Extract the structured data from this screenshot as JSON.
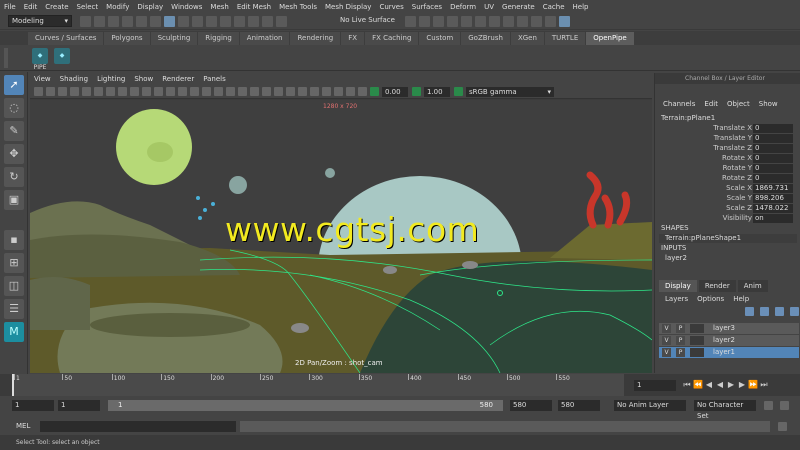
{
  "menubar": [
    "File",
    "Edit",
    "Create",
    "Select",
    "Modify",
    "Display",
    "Windows",
    "Mesh",
    "Edit Mesh",
    "Mesh Tools",
    "Mesh Display",
    "Curves",
    "Surfaces",
    "Deform",
    "UV",
    "Generate",
    "Cache",
    "Help"
  ],
  "statusline": {
    "mode": "Modeling",
    "live_surface": "No Live Surface"
  },
  "shelf": {
    "tabs": [
      "Curves / Surfaces",
      "Polygons",
      "Sculpting",
      "Rigging",
      "Animation",
      "Rendering",
      "FX",
      "FX Caching",
      "Custom",
      "GoZBrush",
      "XGen",
      "TURTLE",
      "OpenPipe"
    ],
    "active_tab": "OpenPipe",
    "icons": [
      "PIPE"
    ]
  },
  "viewport": {
    "menu": [
      "View",
      "Shading",
      "Lighting",
      "Show",
      "Renderer",
      "Panels"
    ],
    "exposure": "0.00",
    "gamma": "1.00",
    "colorspace": "sRGB gamma",
    "resolution_label": "1280 x 720",
    "camera_label": "2D Pan/Zoom : shot_cam"
  },
  "watermark": "www.cgtsj.com",
  "right_panel": {
    "title": "Channel Box / Layer Editor",
    "menu": [
      "Channels",
      "Edit",
      "Object",
      "Show"
    ],
    "object_name": "Terrain:pPlane1",
    "attributes": [
      {
        "label": "Translate X",
        "value": "0"
      },
      {
        "label": "Translate Y",
        "value": "0"
      },
      {
        "label": "Translate Z",
        "value": "0"
      },
      {
        "label": "Rotate X",
        "value": "0"
      },
      {
        "label": "Rotate Y",
        "value": "0"
      },
      {
        "label": "Rotate Z",
        "value": "0"
      },
      {
        "label": "Scale X",
        "value": "1869.731"
      },
      {
        "label": "Scale Y",
        "value": "898.206"
      },
      {
        "label": "Scale Z",
        "value": "1478.022"
      },
      {
        "label": "Visibility",
        "value": "on"
      }
    ],
    "shapes_label": "SHAPES",
    "shape_name": "Terrain:pPlaneShape1",
    "inputs_label": "INPUTS",
    "input_name": "layer2",
    "tabs": [
      "Display",
      "Render",
      "Anim"
    ],
    "active_tab": "Display",
    "layer_menu": [
      "Layers",
      "Options",
      "Help"
    ],
    "layers": [
      {
        "v": "V",
        "p": "P",
        "name": "layer3",
        "selected": false
      },
      {
        "v": "V",
        "p": "P",
        "name": "layer2",
        "selected": false
      },
      {
        "v": "V",
        "p": "P",
        "name": "layer1",
        "selected": true
      }
    ]
  },
  "timeline": {
    "ticks": [
      "1",
      "50",
      "100",
      "150",
      "200",
      "250",
      "300",
      "350",
      "400",
      "450",
      "500",
      "550"
    ],
    "current_frame": "1"
  },
  "range": {
    "start": "1",
    "inner_start": "1",
    "slider_start": "1",
    "slider_end": "580",
    "inner_end": "580",
    "end": "580",
    "anim_layer": "No Anim Layer",
    "character_set": "No Character Set"
  },
  "cmdline": {
    "label": "MEL"
  },
  "helpline": "Select Tool: select an object",
  "colors": {
    "accent": "#5285b8",
    "watermark": "#f2ea20",
    "wire": "#2ee88a"
  }
}
